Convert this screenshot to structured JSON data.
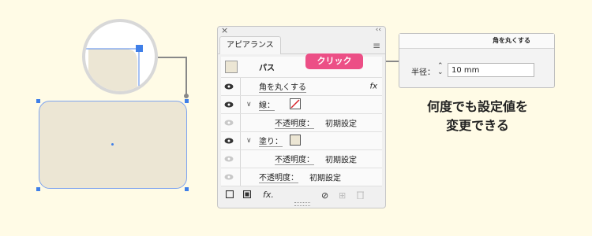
{
  "panel": {
    "title": "アピアランス",
    "rows": {
      "path": "パス",
      "round_corners": "角を丸くする",
      "stroke_label": "線：",
      "stroke_opacity_label": "不透明度：",
      "stroke_opacity_value": "初期設定",
      "fill_label": "塗り：",
      "fill_opacity_label": "不透明度：",
      "fill_opacity_value": "初期設定",
      "opacity_label": "不透明度：",
      "opacity_value": "初期設定"
    },
    "fx_icon": "fx",
    "bottom_fx": "fx."
  },
  "badge": {
    "label": "クリック",
    "color": "#ec4f86"
  },
  "dialog": {
    "title": "角を丸くする",
    "radius_label": "半径：",
    "radius_value": "10 mm"
  },
  "caption": {
    "line1": "何度でも設定値を",
    "line2": "変更できる"
  },
  "colors": {
    "accent": "#3f7fe8",
    "shape_fill": "#ece6d4",
    "background": "#fffbe6"
  }
}
